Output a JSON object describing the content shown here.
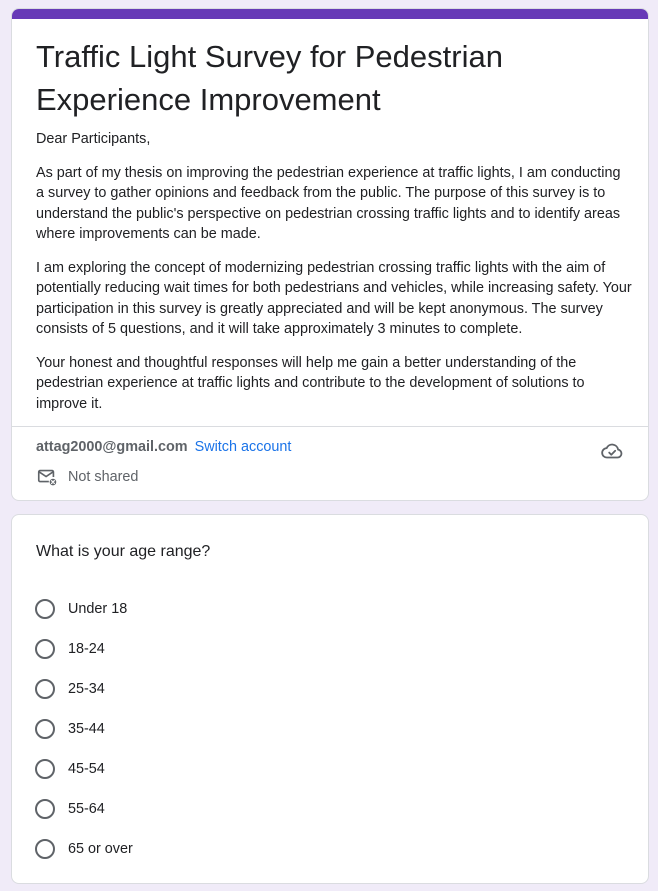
{
  "form": {
    "title": "Traffic Light Survey for Pedestrian Experience Improvement",
    "description": [
      "Dear Participants,",
      "As part of my thesis on improving the pedestrian experience at traffic lights, I am conducting a survey to gather opinions and feedback from the public. The purpose of this survey is to understand the public's perspective on pedestrian crossing traffic lights and to identify areas where improvements can be made.",
      "I am exploring the concept of modernizing pedestrian crossing traffic lights with the aim of potentially reducing wait times for both pedestrians and vehicles, while increasing safety. Your participation in this survey is greatly appreciated and will be kept anonymous. The survey consists of 5 questions, and it will take approximately 3 minutes to complete.",
      "Your honest and thoughtful responses will help me gain a better understanding of the pedestrian experience at traffic lights and contribute to the development of solutions to improve it."
    ],
    "accent_color": "#673ab7"
  },
  "account": {
    "email": "attag2000@gmail.com",
    "switch_label": "Switch account",
    "shared_status": "Not shared",
    "status_icon": "cloud-check-icon",
    "shared_icon": "mail-not-shared-icon"
  },
  "question": {
    "title": "What is your age range?",
    "options": [
      "Under 18",
      "18-24",
      "25-34",
      "35-44",
      "45-54",
      "55-64",
      "65 or over"
    ]
  }
}
